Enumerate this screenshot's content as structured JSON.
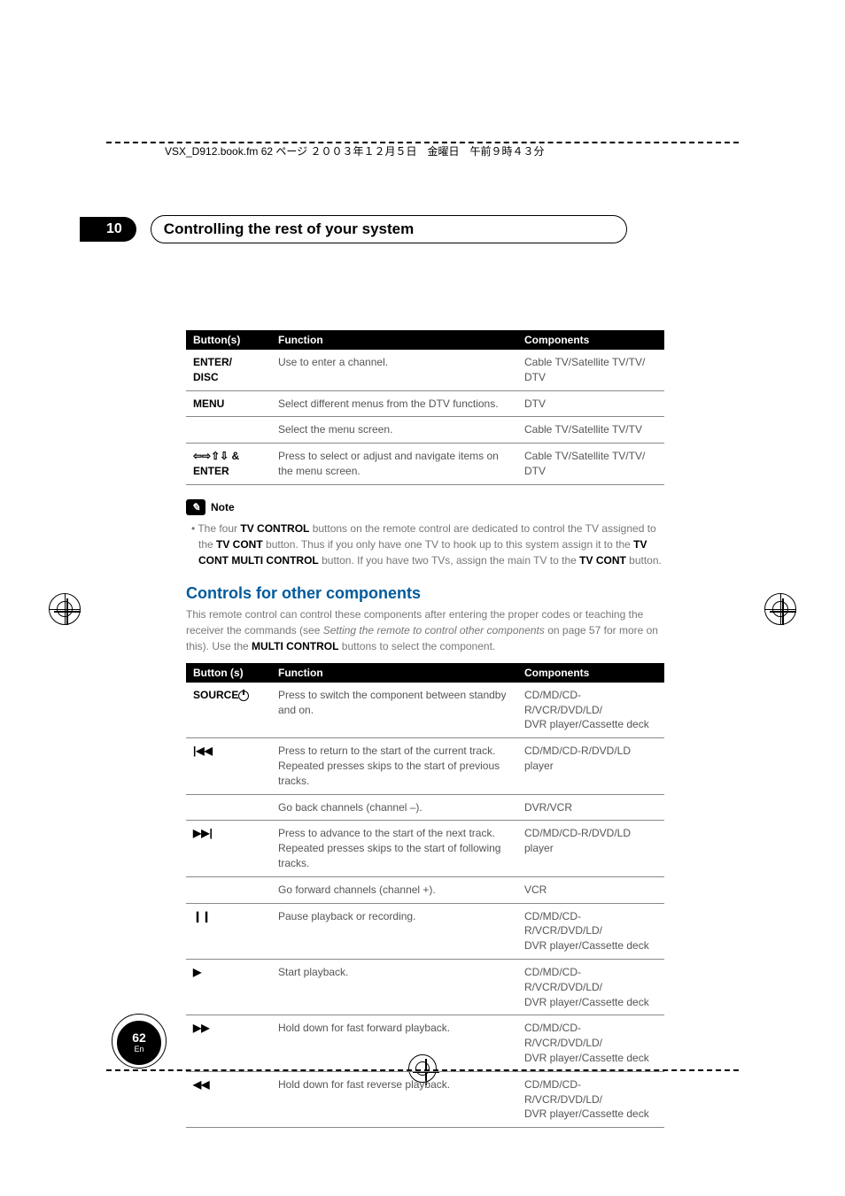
{
  "chapter": {
    "number": "10",
    "title": "Controlling the rest of your system"
  },
  "top_label": "VSX_D912.book.fm  62 ページ  ２００３年１２月５日　金曜日　午前９時４３分",
  "table1": {
    "headers": {
      "col1": "Button(s)",
      "col2": "Function",
      "col3": "Components"
    },
    "rows": [
      {
        "c1": "ENTER/\nDISC",
        "c2": "Use to enter a channel.",
        "c3": "Cable TV/Satellite TV/TV/\nDTV"
      },
      {
        "c1": "MENU",
        "c2": "Select different menus from the DTV functions.",
        "c3": "DTV"
      },
      {
        "c1": "",
        "c2": "Select the menu screen.",
        "c3": "Cable TV/Satellite TV/TV"
      },
      {
        "c1": "⇦⇨⇧⇩ &\nENTER",
        "c2": "Press to select or adjust and navigate items on the menu screen.",
        "c3": "Cable TV/Satellite TV/TV/\nDTV"
      }
    ]
  },
  "note": {
    "label": "Note",
    "body_pre": "The four ",
    "b1": "TV CONTROL",
    "body_mid1": " buttons on the remote control are dedicated to control the TV assigned to the ",
    "b2": "TV CONT",
    "body_mid2": " button. Thus if you only have one TV to hook up to this system assign it to the ",
    "b3": "TV CONT MULTI CONTROL",
    "body_mid3": " button. If you have two TVs, assign the main TV to the ",
    "b4": "TV CONT",
    "body_tail": " button."
  },
  "section": {
    "heading": "Controls for other components",
    "para_pre": "This remote control can control these components after entering the proper codes or teaching the receiver the commands (see ",
    "para_it": "Setting the remote to control other components",
    "para_mid": " on page 57 for more on this). Use the ",
    "para_b": "MULTI CONTROL",
    "para_tail": " buttons to select the component."
  },
  "table2": {
    "headers": {
      "col1": "Button (s)",
      "col2": "Function",
      "col3": "Components"
    },
    "rows": [
      {
        "c1": "SOURCE",
        "c2": "Press to switch the component between standby and on.",
        "c3": "CD/MD/CD-R/VCR/DVD/LD/\nDVR player/Cassette deck"
      },
      {
        "c1": "|◀◀",
        "c2": "Press to return to the start of the current track.\nRepeated presses skips to the start of previous tracks.",
        "c3": "CD/MD/CD-R/DVD/LD player"
      },
      {
        "c1": "",
        "c2": "Go back channels (channel –).",
        "c3": "DVR/VCR"
      },
      {
        "c1": "▶▶|",
        "c2": "Press to advance to the start of the next track.\nRepeated presses skips to the start of following tracks.",
        "c3": "CD/MD/CD-R/DVD/LD player"
      },
      {
        "c1": "",
        "c2": "Go forward channels (channel +).",
        "c3": "VCR"
      },
      {
        "c1": "❙❙",
        "c2": "Pause playback or recording.",
        "c3": "CD/MD/CD-R/VCR/DVD/LD/\nDVR player/Cassette deck"
      },
      {
        "c1": "▶",
        "c2": "Start playback.",
        "c3": "CD/MD/CD-R/VCR/DVD/LD/\nDVR player/Cassette deck"
      },
      {
        "c1": "▶▶",
        "c2": "Hold down for fast forward playback.",
        "c3": "CD/MD/CD-R/VCR/DVD/LD/\nDVR player/Cassette deck"
      },
      {
        "c1": "◀◀",
        "c2": "Hold down for fast reverse playback.",
        "c3": "CD/MD/CD-R/VCR/DVD/LD/\nDVR player/Cassette deck"
      }
    ]
  },
  "pagenum": {
    "num": "62",
    "lang": "En"
  }
}
